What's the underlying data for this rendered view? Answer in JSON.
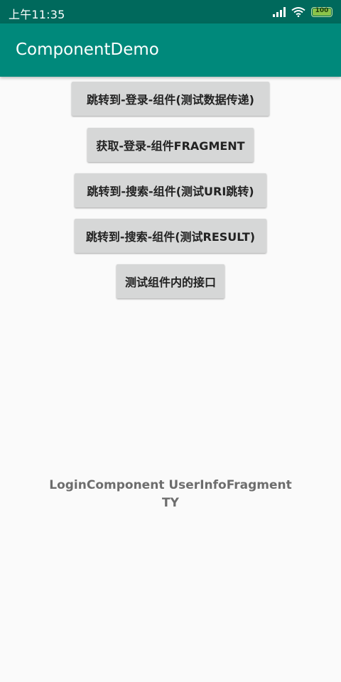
{
  "status_bar": {
    "time": "上午11:35",
    "battery": "100",
    "battery_level": 1.0,
    "background_color": "#00695c",
    "icons": [
      "signal-icon",
      "wifi-icon",
      "battery-icon"
    ]
  },
  "app_bar": {
    "title": "ComponentDemo",
    "background_color": "#00897b"
  },
  "buttons": [
    {
      "label": "跳转到-登录-组件(测试数据传递)"
    },
    {
      "label": "获取-登录-组件FRAGMENT"
    },
    {
      "label": "跳转到-搜索-组件(测试URI跳转)"
    },
    {
      "label": "跳转到-搜索-组件(测试RESULT)"
    },
    {
      "label": "测试组件内的接口"
    }
  ],
  "info": {
    "line1": "LoginComponent UserInfoFragment",
    "line2": "TY"
  }
}
